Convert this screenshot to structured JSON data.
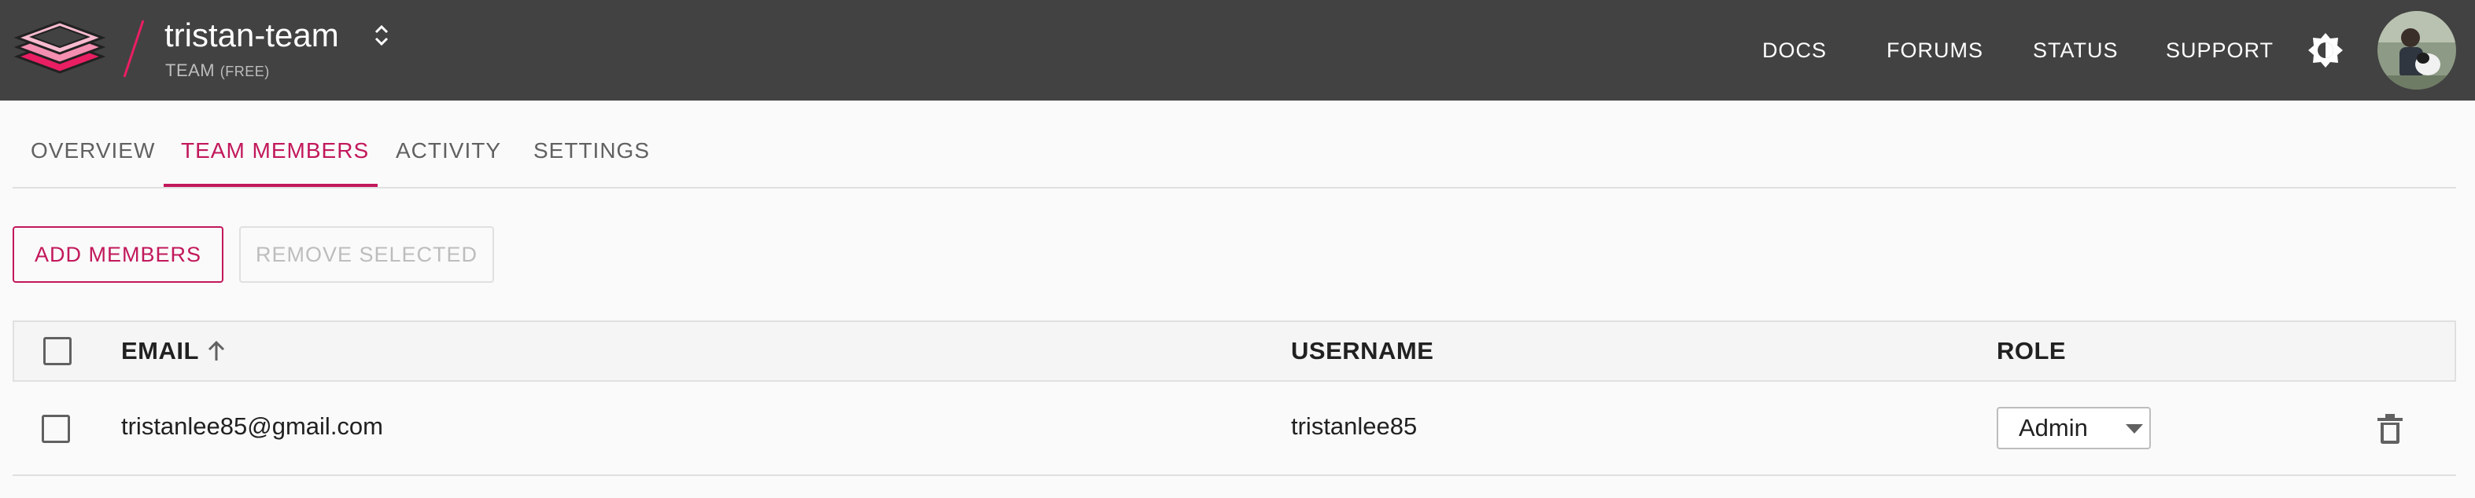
{
  "header": {
    "team_name": "tristan-team",
    "team_plan": "TEAM",
    "team_plan_tier": "(FREE)",
    "nav": {
      "docs": "DOCS",
      "forums": "FORUMS",
      "status": "STATUS",
      "support": "SUPPORT"
    }
  },
  "tabs": [
    {
      "label": "OVERVIEW",
      "active": false
    },
    {
      "label": "TEAM MEMBERS",
      "active": true
    },
    {
      "label": "ACTIVITY",
      "active": false
    },
    {
      "label": "SETTINGS",
      "active": false
    }
  ],
  "actions": {
    "add_label": "ADD MEMBERS",
    "remove_label": "REMOVE SELECTED",
    "remove_disabled": true
  },
  "table": {
    "columns": {
      "email": "EMAIL",
      "username": "USERNAME",
      "role": "ROLE"
    },
    "sort": {
      "column": "email",
      "direction": "ascending"
    },
    "rows": [
      {
        "email": "tristanlee85@gmail.com",
        "username": "tristanlee85",
        "role": "Admin",
        "selected": false
      }
    ]
  },
  "colors": {
    "accent": "#c2185b",
    "topbar": "#424242",
    "background": "#fafafa"
  },
  "icons": {
    "logo": "layered-stack-logo",
    "team_switch": "unfold-icon",
    "theme": "brightness-icon",
    "sort": "arrow-up-icon",
    "delete": "trash-icon",
    "dropdown": "caret-down-icon"
  }
}
